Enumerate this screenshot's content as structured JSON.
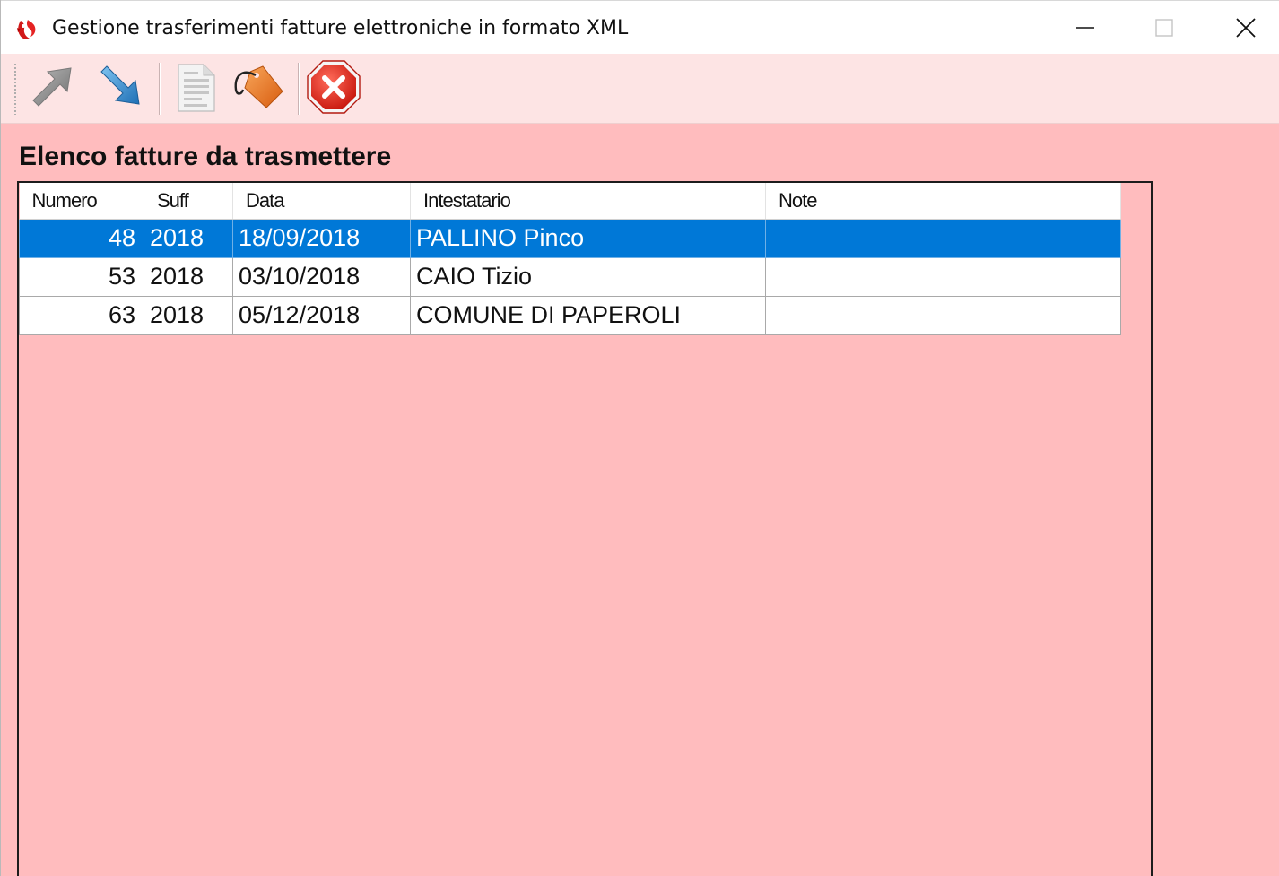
{
  "window": {
    "title": "Gestione trasferimenti fatture elettroniche in formato XML",
    "icons": {
      "app": "app-logo-icon",
      "minimize": "minimize-icon",
      "maximize": "maximize-icon",
      "close": "close-icon"
    }
  },
  "toolbar": {
    "buttons": [
      {
        "name": "upload-arrow-icon"
      },
      {
        "name": "download-arrow-icon"
      },
      {
        "name": "document-icon"
      },
      {
        "name": "tag-icon"
      },
      {
        "name": "exit-icon"
      }
    ]
  },
  "section": {
    "title": "Elenco fatture da trasmettere"
  },
  "grid": {
    "columns": [
      "Numero",
      "Suff",
      "Data",
      "Intestatario",
      "Note"
    ],
    "rows": [
      {
        "numero": "48",
        "suff": "2018",
        "data": "18/09/2018",
        "intestatario": "PALLINO Pinco",
        "note": "",
        "selected": true
      },
      {
        "numero": "53",
        "suff": "2018",
        "data": "03/10/2018",
        "intestatario": "CAIO Tizio",
        "note": "",
        "selected": false
      },
      {
        "numero": "63",
        "suff": "2018",
        "data": "05/12/2018",
        "intestatario": "COMUNE DI PAPEROLI",
        "note": "",
        "selected": false
      }
    ]
  },
  "colors": {
    "background": "#ffbcbe",
    "toolbar": "#fde4e4",
    "selection": "#0078d7"
  }
}
